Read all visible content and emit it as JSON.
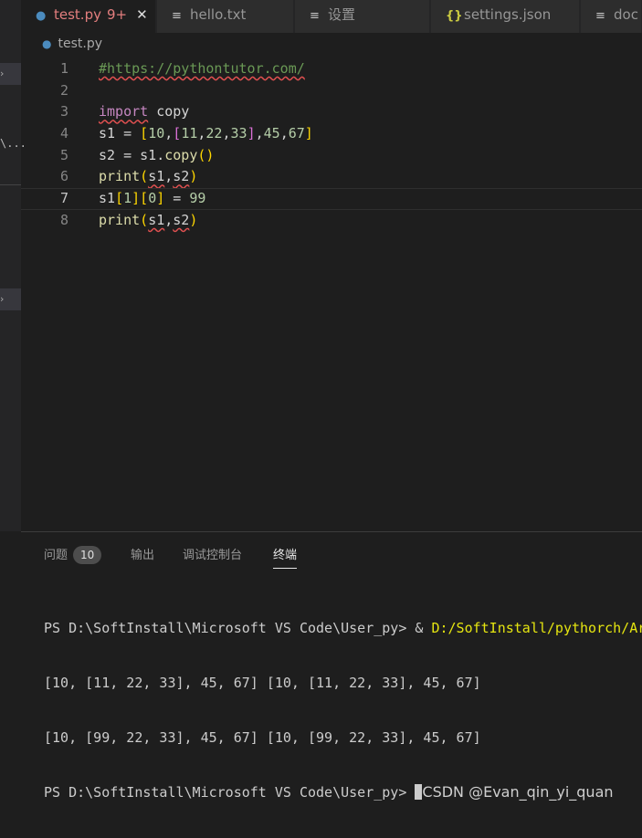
{
  "tabs": [
    {
      "icon": "python-icon",
      "name": "test.py",
      "badge": "9+",
      "close": "✕"
    },
    {
      "icon": "file-lines-icon",
      "name": "hello.txt"
    },
    {
      "icon": "file-lines-icon",
      "name": "设置"
    },
    {
      "icon": "json-braces-icon",
      "name": "settings.json"
    },
    {
      "icon": "file-lines-icon",
      "name": "doc"
    }
  ],
  "breadcrumb": {
    "file": "test.py"
  },
  "sidebar": {
    "truncated_text": "\\..."
  },
  "editor": {
    "line_numbers": [
      "1",
      "2",
      "3",
      "4",
      "5",
      "6",
      "7",
      "8"
    ],
    "lines": [
      "#https://pythontutor.com/",
      "",
      "import copy",
      "s1 = [10,[11,22,33],45,67]",
      "s2 = s1.copy()",
      "print(s1,s2)",
      "s1[1][0] = 99",
      "print(s1,s2)"
    ],
    "current_line": 7
  },
  "panel": {
    "tabs": [
      {
        "label": "问题",
        "count": "10"
      },
      {
        "label": "输出"
      },
      {
        "label": "调试控制台"
      },
      {
        "label": "终端",
        "active": true
      }
    ]
  },
  "terminal": {
    "prompt": "PS D:\\SoftInstall\\Microsoft VS Code\\User_py> ",
    "command_prefix": "& ",
    "command_path": "D:/SoftInstall/pythorch/Ar",
    "output1": "[10, [11, 22, 33], 45, 67] [10, [11, 22, 33], 45, 67]",
    "output2": "[10, [99, 22, 33], 45, 67] [10, [99, 22, 33], 45, 67]",
    "watermark": "CSDN @Evan_qin_yi_quan"
  }
}
